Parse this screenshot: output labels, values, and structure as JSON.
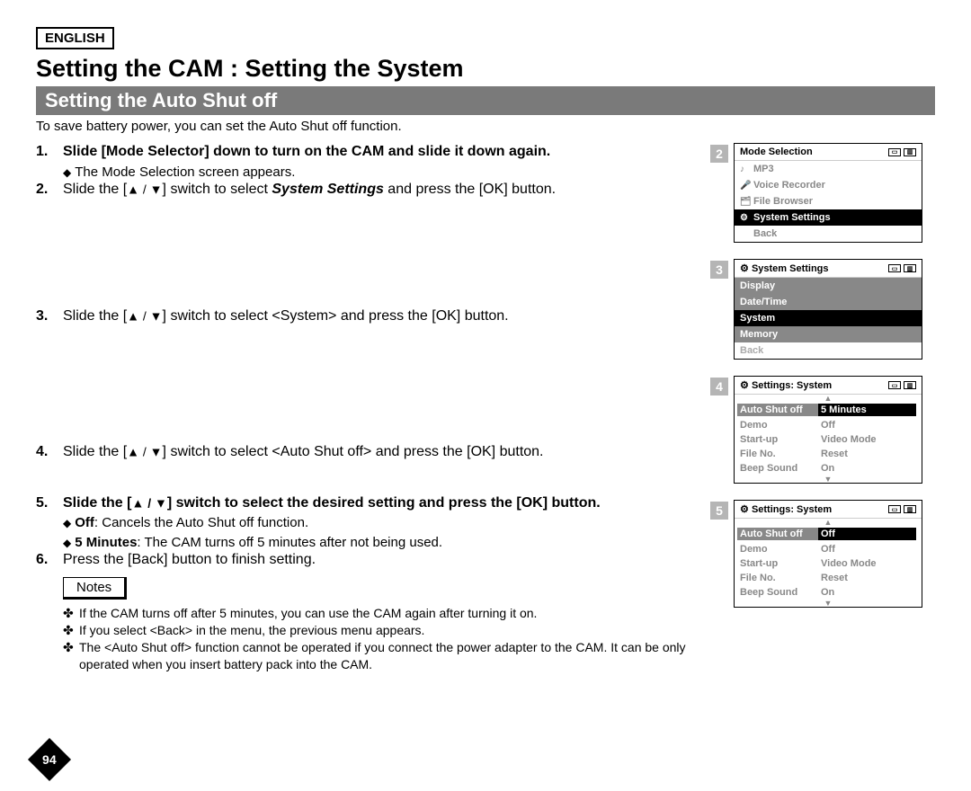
{
  "lang": "ENGLISH",
  "main_title": "Setting the CAM : Setting the System",
  "section_title": "Setting the Auto Shut off",
  "intro": "To save battery power, you can set the Auto Shut off function.",
  "steps": {
    "s1": {
      "num": "1.",
      "text": "Slide [Mode Selector] down to turn on the CAM and slide it down again.",
      "sub": "The Mode Selection screen appears."
    },
    "s2": {
      "num": "2.",
      "pre": "Slide the [",
      "mid": "] switch to select ",
      "ital": "System Settings",
      "post": " and press the [OK] button."
    },
    "s3": {
      "num": "3.",
      "pre": "Slide the [",
      "mid": "] switch to select <System> and press the [OK] button."
    },
    "s4": {
      "num": "4.",
      "pre": "Slide the [",
      "mid": "] switch to select <Auto Shut off> and press the [OK] button."
    },
    "s5": {
      "num": "5.",
      "pre": "Slide the [",
      "mid": "] switch to select the desired setting and press the [OK] button.",
      "sub1_b": "Off",
      "sub1": ": Cancels the Auto Shut off function.",
      "sub2_b": "5 Minutes",
      "sub2": ": The CAM turns off 5 minutes after not being used."
    },
    "s6": {
      "num": "6.",
      "text": "Press the [Back] button to finish setting."
    }
  },
  "notes_label": "Notes",
  "notes": [
    "If the CAM turns off after 5 minutes, you can use the CAM again after turning it on.",
    "If you select <Back> in the menu, the previous menu appears.",
    "The <Auto Shut off> function cannot be operated if you connect the power adapter to the CAM. It can be only operated when you insert battery pack into the CAM."
  ],
  "page_number": "94",
  "screens": {
    "s2": {
      "num": "2",
      "title": "Mode Selection",
      "items": [
        {
          "icon": "♪",
          "label": "MP3",
          "sel": false
        },
        {
          "icon": "🎤",
          "label": "Voice Recorder",
          "sel": false
        },
        {
          "icon": "🗂",
          "label": "File Browser",
          "sel": false
        },
        {
          "icon": "⚙",
          "label": "System Settings",
          "sel": true
        },
        {
          "icon": "",
          "label": "Back",
          "sel": false
        }
      ]
    },
    "s3": {
      "num": "3",
      "title": "System Settings",
      "title_icon": "⚙",
      "items": [
        {
          "label": "Display",
          "style": "greyrow"
        },
        {
          "label": "Date/Time",
          "style": "greyrow"
        },
        {
          "label": "System",
          "style": "selected"
        },
        {
          "label": "Memory",
          "style": "greyrow"
        },
        {
          "label": "Back",
          "style": "pale"
        }
      ]
    },
    "s4": {
      "num": "4",
      "title": "Settings: System",
      "title_icon": "⚙",
      "rows": [
        {
          "k": "Auto Shut off",
          "v": "5 Minutes",
          "sel": true
        },
        {
          "k": "Demo",
          "v": "Off"
        },
        {
          "k": "Start-up",
          "v": "Video Mode"
        },
        {
          "k": "File No.",
          "v": "Reset"
        },
        {
          "k": "Beep Sound",
          "v": "On"
        }
      ]
    },
    "s5": {
      "num": "5",
      "title": "Settings: System",
      "title_icon": "⚙",
      "rows": [
        {
          "k": "Auto Shut off",
          "v": "Off",
          "sel": true
        },
        {
          "k": "Demo",
          "v": "Off"
        },
        {
          "k": "Start-up",
          "v": "Video Mode"
        },
        {
          "k": "File No.",
          "v": "Reset"
        },
        {
          "k": "Beep Sound",
          "v": "On"
        }
      ]
    }
  }
}
